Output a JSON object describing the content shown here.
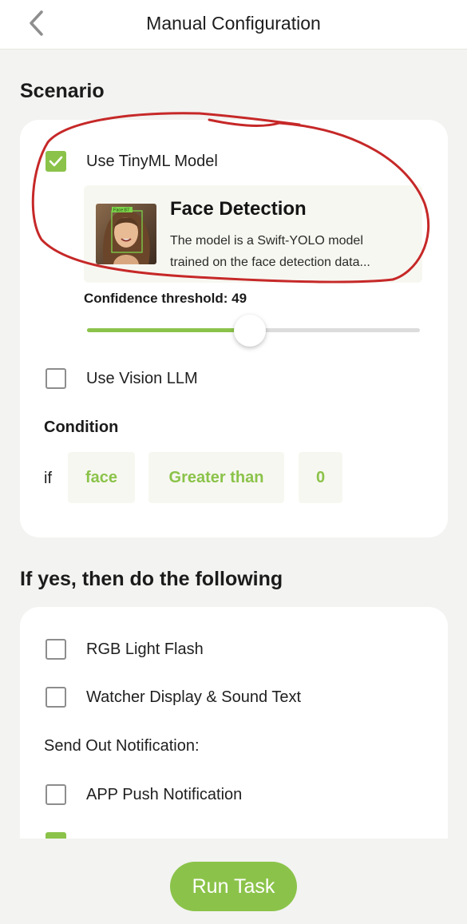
{
  "header": {
    "title": "Manual Configuration"
  },
  "scenario": {
    "title": "Scenario",
    "tinyml": {
      "label": "Use TinyML Model",
      "checked": true
    },
    "model": {
      "name": "Face Detection",
      "description_line1": "The model is a Swift-YOLO model",
      "description_line2": "trained on the face detection data...",
      "thumb_tag": "Face:87"
    },
    "confidence": {
      "label": "Confidence threshold: 49",
      "value": 49
    },
    "vision_llm": {
      "label": "Use Vision LLM",
      "checked": false
    },
    "condition": {
      "title": "Condition",
      "if_label": "if",
      "object": "face",
      "operator": "Greater than",
      "value": "0"
    }
  },
  "actions": {
    "title": "If yes, then do the following",
    "rgb": {
      "label": "RGB Light Flash",
      "checked": false
    },
    "display_sound": {
      "label": "Watcher Display & Sound Text",
      "checked": false
    },
    "notif_label": "Send Out Notification:",
    "app_push": {
      "label": "APP Push Notification",
      "checked": false
    },
    "serial": {
      "checked": true
    }
  },
  "run_button": {
    "label": "Run Task"
  },
  "colors": {
    "accent": "#8bc34a",
    "annotation": "#c62828"
  }
}
